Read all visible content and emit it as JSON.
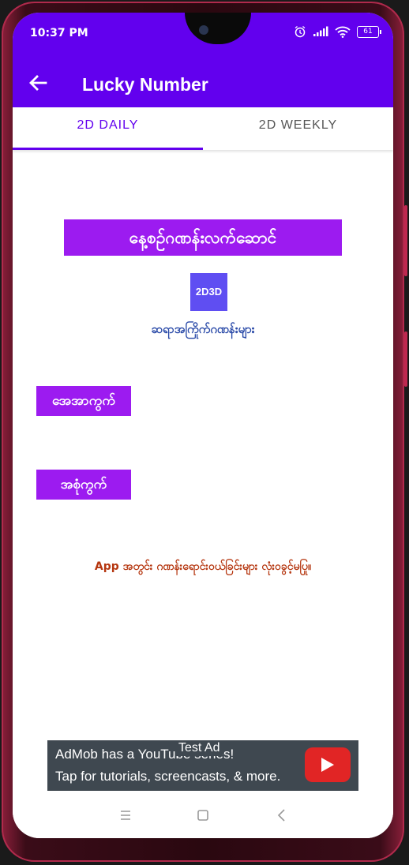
{
  "status_bar": {
    "time": "10:37 PM",
    "battery": "61",
    "icons": [
      "alarm-icon",
      "signal-icon",
      "wifi-icon",
      "battery-icon"
    ]
  },
  "app_bar": {
    "title": "Lucky Number",
    "back_icon": "back-arrow-icon",
    "color": "#6200ee"
  },
  "tabs": [
    {
      "label": "2D DAILY",
      "selected": true
    },
    {
      "label": "2D WEEKLY",
      "selected": false
    }
  ],
  "content": {
    "banner_title": "နေ့စဉ်ဂဏန်းလက်ဆောင်",
    "logo_text": "2D3D",
    "subtitle": "ဆရာအကြိုက်ဂဏန်းများ",
    "morning_button": "အေအာကွက်",
    "evening_button": "အစုံကွက်",
    "notice": "App အတွင်း ဂဏန်းရောင်းဝယ်ခြင်းများ လုံးဝခွင့်မပြု။",
    "accent_color": "#9c1bf0"
  },
  "ad": {
    "tag": "Test Ad",
    "line1": "AdMob has a YouTube series!",
    "line2": "Tap for tutorials, screencasts, & more.",
    "icon": "youtube-play-icon"
  },
  "nav_bar": {
    "icons": [
      "recent-apps-icon",
      "home-icon",
      "back-icon"
    ]
  }
}
